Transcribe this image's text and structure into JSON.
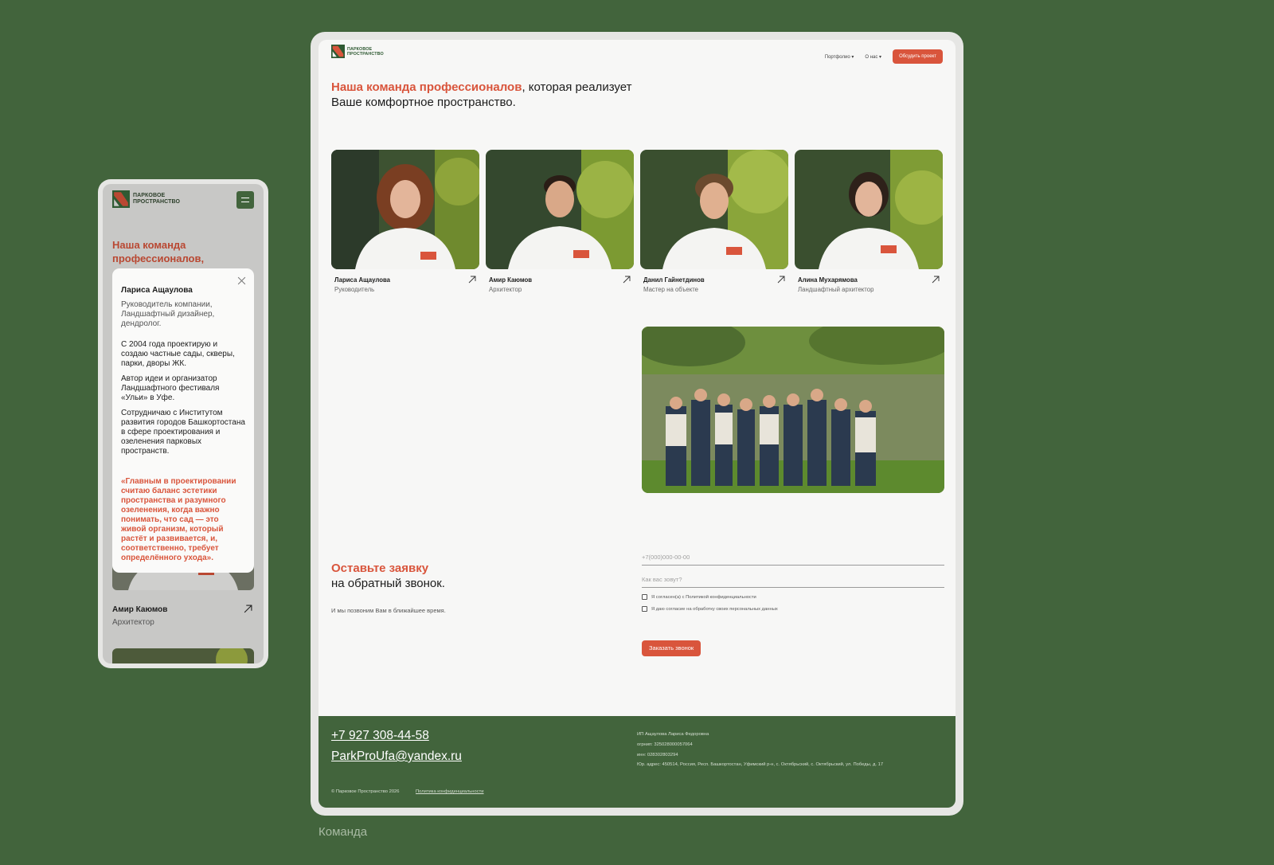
{
  "caption": "Команда",
  "brand": {
    "line1": "ПАРКОВОЕ",
    "line2": "ПРОСТРАНСТВО",
    "accent": "#d9553c",
    "green": "#42643c"
  },
  "desktop": {
    "nav": {
      "portfolio": "Портфолио",
      "about": "О нас",
      "cta": "Обсудить проект"
    },
    "heading": {
      "accent": "Наша команда профессионалов",
      "rest_line1": ", которая реализует",
      "rest_line2": "Ваше комфортное пространство."
    },
    "team": [
      {
        "name": "Лариса Ащаулова",
        "role": "Руководитель"
      },
      {
        "name": "Амир Каюмов",
        "role": "Архитектор"
      },
      {
        "name": "Данил Гайнетдинов",
        "role": "Мастер на объекте"
      },
      {
        "name": "Алина Мухарямова",
        "role": "Ландшафтный архитектор"
      }
    ],
    "form": {
      "title_accent": "Оставьте заявку",
      "title_rest": "на обратный звонок.",
      "subtitle": "И мы позвоним Вам в ближайшее время.",
      "phone_placeholder": "+7(000)000-00-00",
      "name_placeholder": "Как вас зовут?",
      "consent_policy": "Я согласен(а) с Политикой конфиденциальности",
      "consent_data": "Я даю согласие на обработку своих персональных данных",
      "submit": "Заказать звонок"
    },
    "footer": {
      "phone": "+7 927 308-44-58",
      "email": "ParkProUfa@yandex.ru",
      "legal_name": "ИП Ащаулова Лариса Федоровна",
      "ogrnip": "огрнип: 325028000057064",
      "inn": "инн: 028302803294",
      "address": "Юр. адрес: 450514, Россия, Респ. Башкортостан, Уфимский р-н, с. Октябрьский, с. Октябрьский, ул. Победы, д. 17",
      "copyright": "© Парковое Пространство 2026",
      "policy": "Политика конфиденциальности"
    }
  },
  "mobile": {
    "heading": "Наша команда профессионалов,",
    "modal": {
      "name": "Лариса Ащаулова",
      "role": "Руководитель компании, Ландшафтный дизайнер, дендролог.",
      "p1": "С 2004 года проектирую и создаю частные сады, скверы, парки, дворы ЖК.",
      "p2": "Автор идеи и организатор Ландшафтного фестиваля «Ульи» в Уфе.",
      "p3": "Сотрудничаю с Институтом развития городов Башкортостана в сфере проектирования и озеленения парковых пространств.",
      "quote": "«Главным в проектировании считаю баланс эстетики пространства и разумного озеленения, когда важно понимать, что сад — это живой организм, который растёт и развивается, и, соответственно, требует определённого ухода»."
    },
    "card": {
      "name": "Амир Каюмов",
      "role": "Архитектор"
    }
  }
}
